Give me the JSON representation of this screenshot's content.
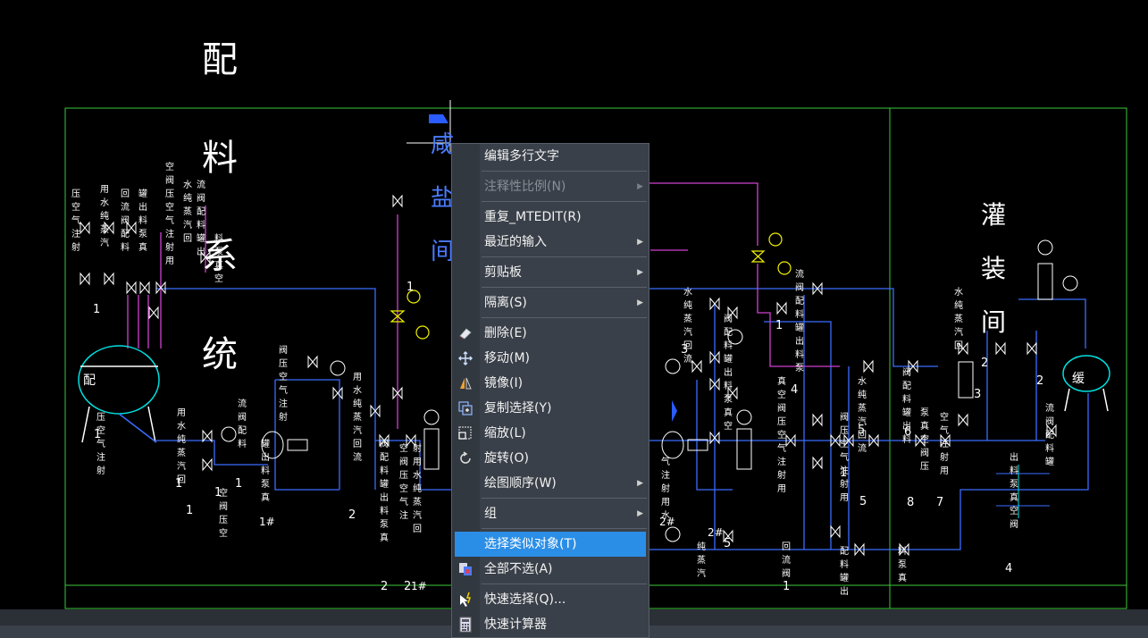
{
  "drawing": {
    "vertical_labels": {
      "left_title": [
        "配",
        "料",
        "系",
        "统"
      ],
      "middle_title": [
        "咸",
        "盐",
        "间"
      ],
      "right_title": [
        "灌",
        "装",
        "间"
      ]
    },
    "tank_left": "配",
    "tank_right": "缓",
    "pump_labels": [
      "1#",
      "2#",
      "1#",
      "2#"
    ],
    "numbers": [
      "1",
      "1",
      "1",
      "1",
      "1",
      "1",
      "2",
      "2",
      "2",
      "3",
      "4",
      "5",
      "5",
      "6",
      "7",
      "8",
      "2",
      "2",
      "3",
      "4",
      "5",
      "1",
      "1",
      "1",
      "1"
    ],
    "small_texts": [
      "压",
      "空",
      "气",
      "注",
      "射",
      "用",
      "水",
      "纯",
      "蒸",
      "汽",
      "回",
      "流",
      "阀",
      "配",
      "料",
      "罐",
      "出",
      "料",
      "泵",
      "真",
      "空",
      "阀"
    ],
    "colors": {
      "frame": "#3cc83c",
      "pipe": "#3a6cff",
      "steam": "#d040d0",
      "text": "#ffffff",
      "valve": "#f0f000"
    }
  },
  "context_menu": {
    "items": [
      {
        "label": "编辑多行文字",
        "icon": "",
        "submenu": false,
        "disabled": false,
        "highlighted": false,
        "sep_after": true
      },
      {
        "label": "注释性比例(N)",
        "icon": "",
        "submenu": true,
        "disabled": true,
        "highlighted": false,
        "sep_after": true
      },
      {
        "label": "重复_MTEDIT(R)",
        "icon": "",
        "submenu": false,
        "disabled": false,
        "highlighted": false,
        "sep_after": false
      },
      {
        "label": "最近的输入",
        "icon": "",
        "submenu": true,
        "disabled": false,
        "highlighted": false,
        "sep_after": true
      },
      {
        "label": "剪贴板",
        "icon": "",
        "submenu": true,
        "disabled": false,
        "highlighted": false,
        "sep_after": true
      },
      {
        "label": "隔离(S)",
        "icon": "",
        "submenu": true,
        "disabled": false,
        "highlighted": false,
        "sep_after": true
      },
      {
        "label": "删除(E)",
        "icon": "eraser-icon",
        "submenu": false,
        "disabled": false,
        "highlighted": false,
        "sep_after": false
      },
      {
        "label": "移动(M)",
        "icon": "move-icon",
        "submenu": false,
        "disabled": false,
        "highlighted": false,
        "sep_after": false
      },
      {
        "label": "镜像(I)",
        "icon": "mirror-icon",
        "submenu": false,
        "disabled": false,
        "highlighted": false,
        "sep_after": false
      },
      {
        "label": "复制选择(Y)",
        "icon": "copy-icon",
        "submenu": false,
        "disabled": false,
        "highlighted": false,
        "sep_after": false
      },
      {
        "label": "缩放(L)",
        "icon": "scale-icon",
        "submenu": false,
        "disabled": false,
        "highlighted": false,
        "sep_after": false
      },
      {
        "label": "旋转(O)",
        "icon": "rotate-icon",
        "submenu": false,
        "disabled": false,
        "highlighted": false,
        "sep_after": false
      },
      {
        "label": "绘图顺序(W)",
        "icon": "",
        "submenu": true,
        "disabled": false,
        "highlighted": false,
        "sep_after": true
      },
      {
        "label": "组",
        "icon": "",
        "submenu": true,
        "disabled": false,
        "highlighted": false,
        "sep_after": true
      },
      {
        "label": "选择类似对象(T)",
        "icon": "",
        "submenu": false,
        "disabled": false,
        "highlighted": true,
        "sep_after": false
      },
      {
        "label": "全部不选(A)",
        "icon": "deselect-icon",
        "submenu": false,
        "disabled": false,
        "highlighted": false,
        "sep_after": true
      },
      {
        "label": "快速选择(Q)...",
        "icon": "quick-select-icon",
        "submenu": false,
        "disabled": false,
        "highlighted": false,
        "sep_after": false
      },
      {
        "label": "快速计算器",
        "icon": "calculator-icon",
        "submenu": false,
        "disabled": false,
        "highlighted": false,
        "sep_after": false
      }
    ]
  }
}
